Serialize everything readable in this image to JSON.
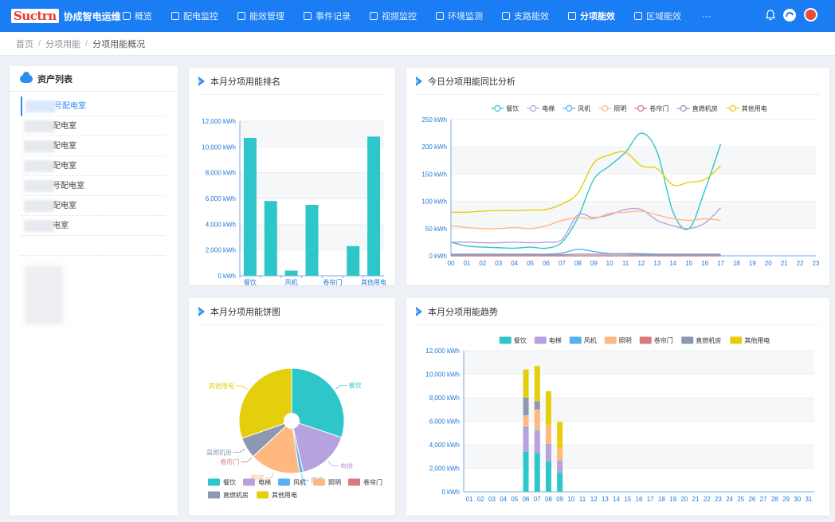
{
  "app": {
    "logo_mark": "Suctrn",
    "title": "协成智电运维"
  },
  "nav": [
    {
      "label": "概览",
      "icon": "dollar-icon",
      "active": false
    },
    {
      "label": "配电监控",
      "icon": "monitor-icon",
      "active": false
    },
    {
      "label": "能效管理",
      "icon": "chart-icon",
      "active": false
    },
    {
      "label": "事件记录",
      "icon": "list-icon",
      "active": false
    },
    {
      "label": "视频监控",
      "icon": "camera-icon",
      "active": false
    },
    {
      "label": "环境监测",
      "icon": "gauge-icon",
      "active": false
    },
    {
      "label": "支路能效",
      "icon": "branch-icon",
      "active": false
    },
    {
      "label": "分项能效",
      "icon": "grid-icon",
      "active": true
    },
    {
      "label": "区域能效",
      "icon": "home-icon",
      "active": false
    }
  ],
  "nav_more": "···",
  "breadcrumb": {
    "home": "首页",
    "level2": "分项用能",
    "current": "分项用能概况"
  },
  "asset_list": {
    "title": "资产列表",
    "items": [
      {
        "label": "号配电室",
        "active": true
      },
      {
        "label": "配电室",
        "active": false
      },
      {
        "label": "配电室",
        "active": false
      },
      {
        "label": "配电室",
        "active": false
      },
      {
        "label": "号配电室",
        "active": false
      },
      {
        "label": "配电室",
        "active": false
      },
      {
        "label": "电室",
        "active": false
      }
    ]
  },
  "colors": {
    "canyin": "#2ec7c9",
    "dianti": "#b6a2de",
    "fengji": "#5ab1ef",
    "zhaoming": "#ffb980",
    "juanlianmen": "#d87a80",
    "zhiranjifang": "#8d98b3",
    "qita": "#e5cf0d",
    "accent": "#2d8cf0"
  },
  "panels": {
    "ranking": "本月分项用能排名",
    "today": "今日分项用能同比分析",
    "pie": "本月分项用能饼图",
    "trend": "本月分项用能趋势"
  },
  "chart_data": [
    {
      "id": "ranking",
      "type": "bar",
      "categories": [
        "餐饮",
        "电梯",
        "风机",
        "照明",
        "卷帘门",
        "直燃机房",
        "其他用电"
      ],
      "xtick_labels": [
        "餐饮",
        "",
        "风机",
        "",
        "卷帘门",
        "",
        "其他用电"
      ],
      "values": [
        10700,
        5800,
        400,
        5500,
        0,
        2300,
        10800
      ],
      "ylim": [
        0,
        12000
      ],
      "yticks": [
        0,
        2000,
        4000,
        6000,
        8000,
        10000,
        12000
      ],
      "ytick_labels": [
        "0 kWh",
        "2,000 kWh",
        "4,000 kWh",
        "6,000 kWh",
        "8,000 kWh",
        "10,000 kWh",
        "12,000 kWh"
      ],
      "grid": true
    },
    {
      "id": "today",
      "type": "line",
      "x": [
        "00",
        "01",
        "02",
        "03",
        "04",
        "05",
        "06",
        "07",
        "08",
        "09",
        "10",
        "11",
        "12",
        "13",
        "14",
        "15",
        "16",
        "17",
        "18",
        "19",
        "20",
        "21",
        "22",
        "23"
      ],
      "ylim": [
        0,
        250
      ],
      "yticks": [
        0,
        50,
        100,
        150,
        200,
        250
      ],
      "ytick_labels": [
        "0 kWh",
        "50 kWh",
        "100 kWh",
        "150 kWh",
        "200 kWh",
        "250 kWh"
      ],
      "legend": "top-center",
      "series": [
        {
          "name": "餐饮",
          "values": [
            25,
            18,
            16,
            15,
            14,
            16,
            14,
            25,
            70,
            140,
            165,
            190,
            225,
            190,
            80,
            50,
            120,
            205
          ]
        },
        {
          "name": "电梯",
          "values": [
            25,
            25,
            24,
            24,
            25,
            24,
            25,
            30,
            75,
            70,
            75,
            85,
            85,
            65,
            55,
            50,
            60,
            88
          ]
        },
        {
          "name": "风机",
          "values": [
            3,
            3,
            3,
            3,
            3,
            3,
            3,
            5,
            12,
            8,
            4,
            4,
            4,
            3,
            3,
            3,
            3,
            3
          ]
        },
        {
          "name": "照明",
          "values": [
            55,
            52,
            50,
            50,
            52,
            50,
            55,
            65,
            70,
            68,
            78,
            80,
            82,
            75,
            68,
            65,
            68,
            65
          ]
        },
        {
          "name": "卷帘门",
          "values": [
            0,
            0,
            0,
            0,
            0,
            0,
            0,
            0,
            0,
            0,
            0,
            0,
            0,
            0,
            0,
            0,
            0,
            0
          ]
        },
        {
          "name": "直燃机房",
          "values": [
            2,
            2,
            2,
            2,
            2,
            2,
            2,
            2,
            3,
            3,
            3,
            3,
            2,
            2,
            2,
            2,
            2,
            2
          ]
        },
        {
          "name": "其他用电",
          "values": [
            80,
            80,
            82,
            83,
            83,
            84,
            85,
            95,
            115,
            170,
            185,
            190,
            165,
            160,
            130,
            135,
            140,
            165
          ]
        }
      ]
    },
    {
      "id": "pie",
      "type": "pie",
      "labels": [
        "餐饮",
        "电梯",
        "风机",
        "照明",
        "卷帘门",
        "直燃机房",
        "其他用电"
      ],
      "values": [
        10700,
        5800,
        400,
        5500,
        0,
        2300,
        10800
      ],
      "legend": "bottom"
    },
    {
      "id": "trend",
      "type": "bar",
      "stacked": true,
      "categories": [
        "01",
        "02",
        "03",
        "04",
        "05",
        "06",
        "07",
        "08",
        "09",
        "10",
        "11",
        "12",
        "13",
        "14",
        "15",
        "16",
        "17",
        "18",
        "19",
        "20",
        "21",
        "22",
        "23",
        "24",
        "25",
        "26",
        "27",
        "28",
        "29",
        "30",
        "31"
      ],
      "ylim": [
        0,
        12000
      ],
      "yticks": [
        0,
        2000,
        4000,
        6000,
        8000,
        10000,
        12000
      ],
      "ytick_labels": [
        "0 kWh",
        "2,000 kWh",
        "4,000 kWh",
        "6,000 kWh",
        "8,000 kWh",
        "10,000 kWh",
        "12,000 kWh"
      ],
      "legend": "top-center",
      "series": [
        {
          "name": "餐饮",
          "values": [
            0,
            0,
            0,
            0,
            0,
            3400,
            3300,
            2600,
            1600,
            0,
            0,
            0,
            0,
            0,
            0,
            0,
            0,
            0,
            0,
            0,
            0,
            0,
            0,
            0,
            0,
            0,
            0,
            0,
            0,
            0,
            0
          ]
        },
        {
          "name": "电梯",
          "values": [
            0,
            0,
            0,
            0,
            0,
            2000,
            1800,
            1400,
            1000,
            0,
            0,
            0,
            0,
            0,
            0,
            0,
            0,
            0,
            0,
            0,
            0,
            0,
            0,
            0,
            0,
            0,
            0,
            0,
            0,
            0,
            0
          ]
        },
        {
          "name": "风机",
          "values": [
            0,
            0,
            0,
            0,
            0,
            100,
            100,
            50,
            50,
            0,
            0,
            0,
            0,
            0,
            0,
            0,
            0,
            0,
            0,
            0,
            0,
            0,
            0,
            0,
            0,
            0,
            0,
            0,
            0,
            0,
            0
          ]
        },
        {
          "name": "照明",
          "values": [
            0,
            0,
            0,
            0,
            0,
            1000,
            1800,
            1600,
            1000,
            0,
            0,
            0,
            0,
            0,
            0,
            0,
            0,
            0,
            0,
            0,
            0,
            0,
            0,
            0,
            0,
            0,
            0,
            0,
            0,
            0,
            0
          ]
        },
        {
          "name": "卷帘门",
          "values": [
            0,
            0,
            0,
            0,
            0,
            0,
            0,
            0,
            0,
            0,
            0,
            0,
            0,
            0,
            0,
            0,
            0,
            0,
            0,
            0,
            0,
            0,
            0,
            0,
            0,
            0,
            0,
            0,
            0,
            0,
            0
          ]
        },
        {
          "name": "直燃机房",
          "values": [
            0,
            0,
            0,
            0,
            0,
            1500,
            700,
            0,
            0,
            0,
            0,
            0,
            0,
            0,
            0,
            0,
            0,
            0,
            0,
            0,
            0,
            0,
            0,
            0,
            0,
            0,
            0,
            0,
            0,
            0,
            0
          ]
        },
        {
          "name": "其他用电",
          "values": [
            0,
            0,
            0,
            0,
            0,
            2400,
            3000,
            2900,
            2300,
            0,
            0,
            0,
            0,
            0,
            0,
            0,
            0,
            0,
            0,
            0,
            0,
            0,
            0,
            0,
            0,
            0,
            0,
            0,
            0,
            0,
            0
          ]
        }
      ]
    }
  ]
}
